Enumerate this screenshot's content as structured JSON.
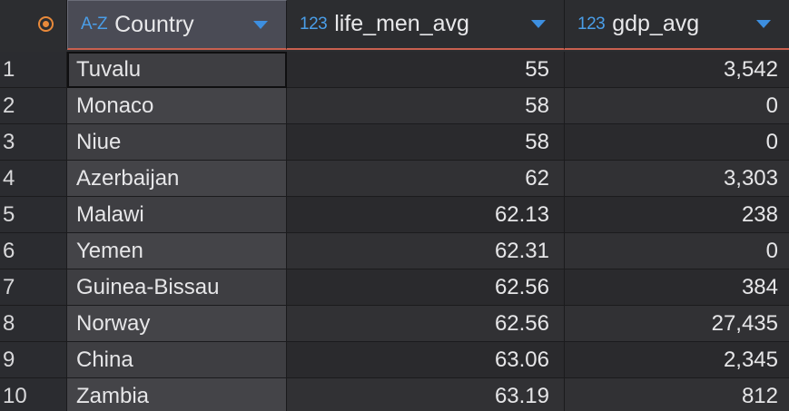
{
  "columns": [
    {
      "type_icon": "A-Z",
      "label": "Country"
    },
    {
      "type_icon": "123",
      "label": "life_men_avg"
    },
    {
      "type_icon": "123",
      "label": "gdp_avg"
    }
  ],
  "rows": [
    {
      "num": "1",
      "country": "Tuvalu",
      "life": "55",
      "gdp": "3,542"
    },
    {
      "num": "2",
      "country": "Monaco",
      "life": "58",
      "gdp": "0"
    },
    {
      "num": "3",
      "country": "Niue",
      "life": "58",
      "gdp": "0"
    },
    {
      "num": "4",
      "country": "Azerbaijan",
      "life": "62",
      "gdp": "3,303"
    },
    {
      "num": "5",
      "country": "Malawi",
      "life": "62.13",
      "gdp": "238"
    },
    {
      "num": "6",
      "country": "Yemen",
      "life": "62.31",
      "gdp": "0"
    },
    {
      "num": "7",
      "country": "Guinea-Bissau",
      "life": "62.56",
      "gdp": "384"
    },
    {
      "num": "8",
      "country": "Norway",
      "life": "62.56",
      "gdp": "27,435"
    },
    {
      "num": "9",
      "country": "China",
      "life": "63.06",
      "gdp": "2,345"
    },
    {
      "num": "10",
      "country": "Zambia",
      "life": "63.19",
      "gdp": "812"
    }
  ],
  "colors": {
    "accent_orange": "#e8893a",
    "type_icon_blue": "#4a9ee8",
    "header_underline": "#c9604f"
  }
}
